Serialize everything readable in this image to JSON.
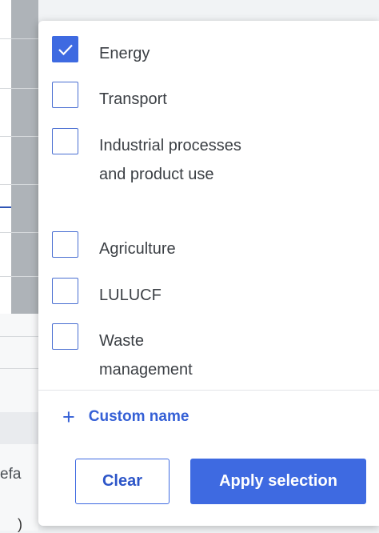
{
  "background": {
    "fragment_text": "efa",
    "fragment_glyph": ")"
  },
  "options": [
    {
      "label": "Energy",
      "checked": true
    },
    {
      "label": "Transport",
      "checked": false
    },
    {
      "label": "Industrial processes and product use",
      "checked": false
    },
    {
      "label": "Agriculture",
      "checked": false
    },
    {
      "label": "LULUCF",
      "checked": false
    },
    {
      "label": "Waste management",
      "checked": false
    }
  ],
  "custom": {
    "icon": "plus-icon",
    "label": "Custom name"
  },
  "actions": {
    "clear_label": "Clear",
    "apply_label": "Apply selection"
  },
  "colors": {
    "accent": "#3e6ae1",
    "text": "#3b3f44"
  }
}
